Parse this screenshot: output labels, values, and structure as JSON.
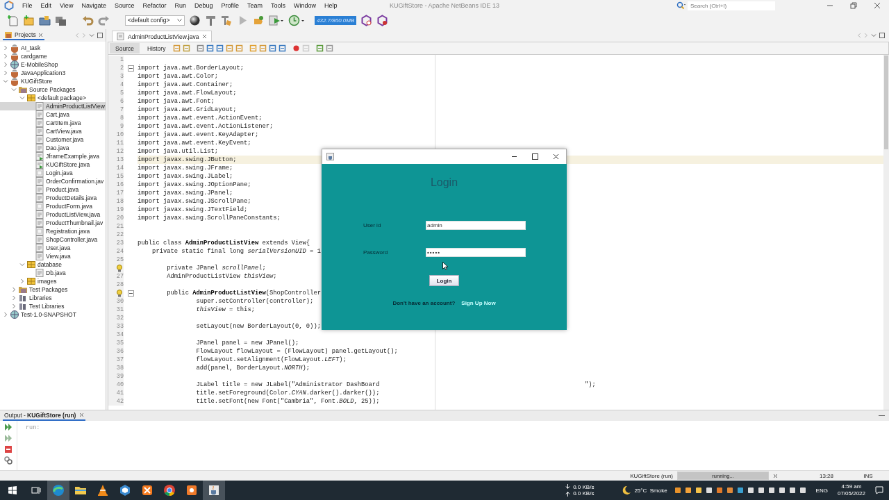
{
  "window": {
    "title": "KUGiftStore - Apache NetBeans IDE 13"
  },
  "menu": [
    "File",
    "Edit",
    "View",
    "Navigate",
    "Source",
    "Refactor",
    "Run",
    "Debug",
    "Profile",
    "Team",
    "Tools",
    "Window",
    "Help"
  ],
  "search": {
    "placeholder": "Search (Ctrl+I)"
  },
  "toolbar": {
    "config": "<default config>",
    "memory": "432.7/860.0MB"
  },
  "projects": {
    "title": "Projects",
    "tree": [
      {
        "label": "AI_task",
        "kind": "project",
        "expanded": false,
        "selected": false
      },
      {
        "label": "cardgame",
        "kind": "project",
        "expanded": false,
        "selected": false
      },
      {
        "label": "E-MobileShop",
        "kind": "web",
        "expanded": false,
        "selected": false
      },
      {
        "label": "JavaApplication3",
        "kind": "project",
        "expanded": false,
        "selected": false
      },
      {
        "label": "KUGiftStore",
        "kind": "project",
        "expanded": true,
        "selected": false,
        "children": [
          {
            "label": "Source Packages",
            "kind": "folder",
            "expanded": true,
            "selected": false,
            "children": [
              {
                "label": "<default package>",
                "kind": "package",
                "expanded": true,
                "selected": false,
                "children": [
                  {
                    "label": "AdminProductListView",
                    "kind": "file",
                    "selected": true
                  },
                  {
                    "label": "Cart.java",
                    "kind": "file",
                    "selected": false
                  },
                  {
                    "label": "CartItem.java",
                    "kind": "file",
                    "selected": false
                  },
                  {
                    "label": "CartView.java",
                    "kind": "file",
                    "selected": false
                  },
                  {
                    "label": "Customer.java",
                    "kind": "file",
                    "selected": false
                  },
                  {
                    "label": "Dao.java",
                    "kind": "file",
                    "selected": false
                  },
                  {
                    "label": "JframeExample.java",
                    "kind": "main",
                    "selected": false
                  },
                  {
                    "label": "KUGiftStore.java",
                    "kind": "main",
                    "selected": false
                  },
                  {
                    "label": "Login.java",
                    "kind": "form",
                    "selected": false
                  },
                  {
                    "label": "OrderConfirmation.jav",
                    "kind": "file",
                    "selected": false
                  },
                  {
                    "label": "Product.java",
                    "kind": "file",
                    "selected": false
                  },
                  {
                    "label": "ProductDetails.java",
                    "kind": "file",
                    "selected": false
                  },
                  {
                    "label": "ProductForm.java",
                    "kind": "form",
                    "selected": false
                  },
                  {
                    "label": "ProductListView.java",
                    "kind": "file",
                    "selected": false
                  },
                  {
                    "label": "ProductThumbnail.jav",
                    "kind": "file",
                    "selected": false
                  },
                  {
                    "label": "Registration.java",
                    "kind": "form",
                    "selected": false
                  },
                  {
                    "label": "ShopController.java",
                    "kind": "file",
                    "selected": false
                  },
                  {
                    "label": "User.java",
                    "kind": "file",
                    "selected": false
                  },
                  {
                    "label": "View.java",
                    "kind": "file",
                    "selected": false
                  }
                ]
              },
              {
                "label": "database",
                "kind": "package",
                "expanded": true,
                "selected": false,
                "children": [
                  {
                    "label": "Db.java",
                    "kind": "file",
                    "selected": false
                  }
                ]
              },
              {
                "label": "images",
                "kind": "package",
                "expanded": false,
                "selected": false
              }
            ]
          },
          {
            "label": "Test Packages",
            "kind": "folder",
            "expanded": false,
            "selected": false
          },
          {
            "label": "Libraries",
            "kind": "library",
            "expanded": false,
            "selected": false
          },
          {
            "label": "Test Libraries",
            "kind": "library",
            "expanded": false,
            "selected": false
          }
        ]
      },
      {
        "label": "Test-1.0-SNAPSHOT",
        "kind": "web",
        "expanded": false,
        "selected": false
      }
    ]
  },
  "editor": {
    "tabs": [
      {
        "label": "AdminProductListView.java",
        "selected": true
      }
    ],
    "views": [
      {
        "label": "Source",
        "selected": true
      },
      {
        "label": "History",
        "selected": false
      }
    ],
    "lines": [
      {
        "num": "1",
        "current": false
      },
      {
        "num": "2",
        "text": "import java.awt.BorderLayout;",
        "fold": true,
        "current": false
      },
      {
        "num": "3",
        "text": "import java.awt.Color;",
        "current": false
      },
      {
        "num": "4",
        "text": "import java.awt.Container;",
        "current": false
      },
      {
        "num": "5",
        "text": "import java.awt.FlowLayout;",
        "current": false
      },
      {
        "num": "6",
        "text": "import java.awt.Font;",
        "current": false
      },
      {
        "num": "7",
        "text": "import java.awt.GridLayout;",
        "current": false
      },
      {
        "num": "8",
        "text": "import java.awt.event.ActionEvent;",
        "current": false
      },
      {
        "num": "9",
        "text": "import java.awt.event.ActionListener;",
        "current": false
      },
      {
        "num": "10",
        "text": "import java.awt.event.KeyAdapter;",
        "current": false
      },
      {
        "num": "11",
        "text": "import java.awt.event.KeyEvent;",
        "current": false
      },
      {
        "num": "12",
        "text": "import java.util.List;",
        "current": false
      },
      {
        "num": "13",
        "text": "import javax.swing.JButton;",
        "current": true
      },
      {
        "num": "14",
        "text": "import javax.swing.JFrame;",
        "current": false
      },
      {
        "num": "15",
        "text": "import javax.swing.JLabel;",
        "current": false
      },
      {
        "num": "16",
        "text": "import javax.swing.JOptionPane;",
        "current": false
      },
      {
        "num": "17",
        "text": "import javax.swing.JPanel;",
        "current": false
      },
      {
        "num": "18",
        "text": "import javax.swing.JScrollPane;",
        "current": false
      },
      {
        "num": "19",
        "text": "import javax.swing.JTextField;",
        "current": false
      },
      {
        "num": "20",
        "text": "import javax.swing.ScrollPaneConstants;",
        "current": false
      },
      {
        "num": "21",
        "current": false
      },
      {
        "num": "22",
        "current": false
      },
      {
        "num": "23",
        "text": "public class **AdminProductListView** extends View{",
        "current": false
      },
      {
        "num": "24",
        "text": "    private static final long *serialVersionUID* = 1",
        "current": false
      },
      {
        "num": "25",
        "current": false
      },
      {
        "hint": true,
        "text": "        private JPanel *scrollPanel*;",
        "current": false
      },
      {
        "num": "27",
        "text": "        AdminProductListView *thisView*;",
        "current": false
      },
      {
        "num": "28",
        "current": false
      },
      {
        "hint": true,
        "text": "        public **AdminProductListView**(ShopController",
        "fold": true,
        "current": false
      },
      {
        "num": "30",
        "text": "                super.setController(controller);",
        "current": false
      },
      {
        "num": "31",
        "text": "                *thisView* = this;",
        "current": false
      },
      {
        "num": "32",
        "current": false
      },
      {
        "num": "33",
        "text": "                setLayout(new BorderLayout(0, 0));",
        "current": false
      },
      {
        "num": "34",
        "current": false
      },
      {
        "num": "35",
        "text": "                JPanel panel = new JPanel();",
        "current": false
      },
      {
        "num": "36",
        "text": "                FlowLayout flowLayout = (FlowLayout) panel.getLayout();",
        "current": false
      },
      {
        "num": "37",
        "text": "                flowLayout.setAlignment(FlowLayout.*LEFT*);",
        "current": false
      },
      {
        "num": "38",
        "text": "                add(panel, BorderLayout.*NORTH*);",
        "current": false
      },
      {
        "num": "39",
        "current": false
      },
      {
        "num": "40",
        "text": "                JLabel title = new JLabel(\"Administrator DashBoard                                                        \");",
        "current": false
      },
      {
        "num": "41",
        "text": "                title.setForeground(Color.*CYAN*.darker().darker());",
        "current": false
      },
      {
        "num": "42",
        "text": "                title.setFont(new Font(\"Cambria\", Font.*BOLD*, 25));",
        "current": false
      }
    ]
  },
  "dialog": {
    "heading": "Login",
    "fields": [
      {
        "label": "User id",
        "value": "admin",
        "kind": "text"
      },
      {
        "label": "Password",
        "value": "•••••",
        "kind": "password"
      }
    ],
    "button": "Login",
    "prompt": "Don't have an account?",
    "link": "Sign Up Now"
  },
  "output": {
    "tab": "Output - **KUGiftStore (run)**",
    "text": "run:"
  },
  "status_bar": {
    "task": "KUGiftStore (run)",
    "progress": {
      "label": "running...",
      "level": 1
    },
    "position": "13:28",
    "mode": "INS"
  },
  "taskbar": {
    "apps": [
      {
        "kind": "edge",
        "highlighted": true
      },
      {
        "kind": "explorer",
        "highlighted": false
      },
      {
        "kind": "vlc",
        "highlighted": false
      },
      {
        "kind": "cube",
        "highlighted": false
      },
      {
        "kind": "xampp",
        "highlighted": false
      },
      {
        "kind": "chrome",
        "highlighted": false
      },
      {
        "kind": "orange",
        "highlighted": false
      },
      {
        "kind": "java",
        "highlighted": true
      }
    ],
    "upload": "0.0 KB/s",
    "download": "0.0 KB/s",
    "weather": "25°C  Smoke",
    "language": "ENG",
    "time": "4:59 am",
    "date": "07/05/2022"
  }
}
